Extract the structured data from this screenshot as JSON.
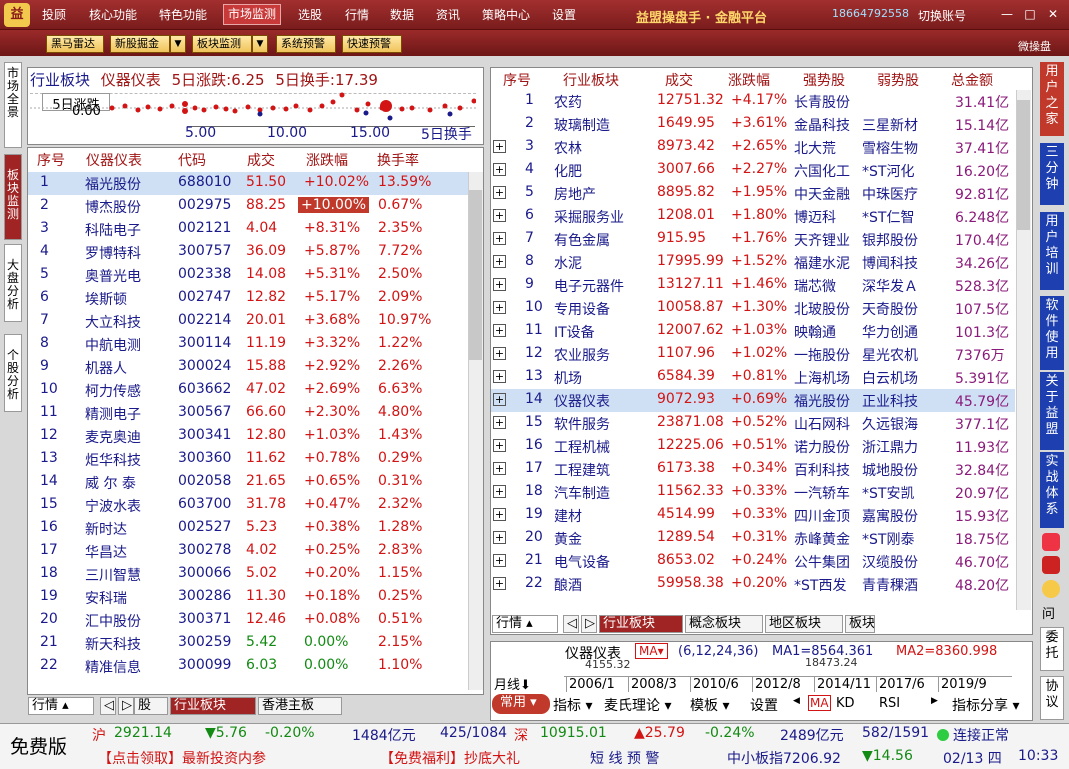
{
  "topbar": {
    "logo": "益",
    "menus": [
      "投顾",
      "核心功能",
      "特色功能",
      "市场监测",
      "选股",
      "行情",
      "数据",
      "资讯",
      "策略中心",
      "设置"
    ],
    "selected_menu": "市场监测",
    "brand": "益盟操盘手 · 金融平台",
    "phone": "18664792558",
    "switch_account": "切换账号",
    "window_controls": [
      "—",
      "□",
      "✕"
    ]
  },
  "toolbar": {
    "buttons": [
      "黑马雷达",
      "新股掘金",
      "板块监测",
      "系统预警",
      "快速预警"
    ],
    "right_label": "微操盘"
  },
  "left_tabs": [
    "市场全景",
    "板块监测",
    "大盘分析",
    "个股分析"
  ],
  "mini_chart": {
    "title": "行业板块",
    "sector": "仪器仪表",
    "info1": "5日涨跌:6.25",
    "info2": "5日换手:17.39",
    "legend": "5日涨跌",
    "y0": "0.00",
    "ticks": [
      "5.00",
      "10.00",
      "15.00"
    ],
    "xlabel": "5日换手"
  },
  "left_table": {
    "headers": [
      "序号",
      "仪器仪表",
      "代码",
      "成交",
      "涨跌幅",
      "换手率"
    ],
    "rows": [
      [
        "1",
        "福光股份",
        "688010",
        "51.50",
        "+10.02%",
        "13.59%"
      ],
      [
        "2",
        "博杰股份",
        "002975",
        "88.25",
        "+10.00%",
        "0.67%"
      ],
      [
        "3",
        "科陆电子",
        "002121",
        "4.04",
        "+8.31%",
        "2.35%"
      ],
      [
        "4",
        "罗博特科",
        "300757",
        "36.09",
        "+5.87%",
        "7.72%"
      ],
      [
        "5",
        "奥普光电",
        "002338",
        "14.08",
        "+5.31%",
        "2.50%"
      ],
      [
        "6",
        "埃斯顿",
        "002747",
        "12.82",
        "+5.17%",
        "2.09%"
      ],
      [
        "7",
        "大立科技",
        "002214",
        "20.01",
        "+3.68%",
        "10.97%"
      ],
      [
        "8",
        "中航电测",
        "300114",
        "11.19",
        "+3.32%",
        "1.22%"
      ],
      [
        "9",
        "机器人",
        "300024",
        "15.88",
        "+2.92%",
        "2.26%"
      ],
      [
        "10",
        "柯力传感",
        "603662",
        "47.02",
        "+2.69%",
        "6.63%"
      ],
      [
        "11",
        "精测电子",
        "300567",
        "66.60",
        "+2.30%",
        "4.80%"
      ],
      [
        "12",
        "麦克奥迪",
        "300341",
        "12.80",
        "+1.03%",
        "1.43%"
      ],
      [
        "13",
        "炬华科技",
        "300360",
        "11.62",
        "+0.78%",
        "0.29%"
      ],
      [
        "14",
        "威 尔 泰",
        "002058",
        "21.65",
        "+0.65%",
        "0.31%"
      ],
      [
        "15",
        "宁波水表",
        "603700",
        "31.78",
        "+0.47%",
        "2.32%"
      ],
      [
        "16",
        "新时达",
        "002527",
        "5.23",
        "+0.38%",
        "1.28%"
      ],
      [
        "17",
        "华昌达",
        "300278",
        "4.02",
        "+0.25%",
        "2.83%"
      ],
      [
        "18",
        "三川智慧",
        "300066",
        "5.02",
        "+0.20%",
        "1.15%"
      ],
      [
        "19",
        "安科瑞",
        "300286",
        "11.30",
        "+0.18%",
        "0.25%"
      ],
      [
        "20",
        "汇中股份",
        "300371",
        "12.46",
        "+0.08%",
        "0.51%"
      ],
      [
        "21",
        "新天科技",
        "300259",
        "5.42",
        "0.00%",
        "2.15%"
      ],
      [
        "22",
        "精准信息",
        "300099",
        "6.03",
        "0.00%",
        "1.10%"
      ]
    ]
  },
  "left_bottom_tabs": [
    "行情",
    "股",
    "行业板块",
    "香港主板"
  ],
  "right_table": {
    "headers": [
      "序号",
      "行业板块",
      "成交",
      "涨跌幅",
      "强势股",
      "弱势股",
      "总金额"
    ],
    "rows": [
      [
        "1",
        "农药",
        "12751.32",
        "+4.17%",
        "长青股份",
        "",
        "31.41亿"
      ],
      [
        "2",
        "玻璃制造",
        "1649.95",
        "+3.61%",
        "金晶科技",
        "三星新材",
        "15.14亿"
      ],
      [
        "3",
        "农林",
        "8973.42",
        "+2.65%",
        "北大荒",
        "雪榕生物",
        "37.41亿"
      ],
      [
        "4",
        "化肥",
        "3007.66",
        "+2.27%",
        "六国化工",
        "*ST河化",
        "16.20亿"
      ],
      [
        "5",
        "房地产",
        "8895.82",
        "+1.95%",
        "中天金融",
        "中珠医疗",
        "92.81亿"
      ],
      [
        "6",
        "采掘服务业",
        "1208.01",
        "+1.80%",
        "博迈科",
        "*ST仁智",
        "6.248亿"
      ],
      [
        "7",
        "有色金属",
        "915.95",
        "+1.76%",
        "天齐锂业",
        "银邦股份",
        "170.4亿"
      ],
      [
        "8",
        "水泥",
        "17995.99",
        "+1.52%",
        "福建水泥",
        "博闻科技",
        "34.26亿"
      ],
      [
        "9",
        "电子元器件",
        "13127.11",
        "+1.46%",
        "瑞芯微",
        "深华发Ａ",
        "528.3亿"
      ],
      [
        "10",
        "专用设备",
        "10058.87",
        "+1.30%",
        "北玻股份",
        "天奇股份",
        "107.5亿"
      ],
      [
        "11",
        "IT设备",
        "12007.62",
        "+1.03%",
        "映翰通",
        "华力创通",
        "101.3亿"
      ],
      [
        "12",
        "农业服务",
        "1107.96",
        "+1.02%",
        "一拖股份",
        "星光农机",
        "7376万"
      ],
      [
        "13",
        "机场",
        "6584.39",
        "+0.81%",
        "上海机场",
        "白云机场",
        "5.391亿"
      ],
      [
        "14",
        "仪器仪表",
        "9072.93",
        "+0.69%",
        "福光股份",
        "正业科技",
        "45.79亿"
      ],
      [
        "15",
        "软件服务",
        "23871.08",
        "+0.52%",
        "山石网科",
        "久远银海",
        "377.1亿"
      ],
      [
        "16",
        "工程机械",
        "12225.06",
        "+0.51%",
        "诺力股份",
        "浙江鼎力",
        "11.93亿"
      ],
      [
        "17",
        "工程建筑",
        "6173.38",
        "+0.34%",
        "百利科技",
        "城地股份",
        "32.84亿"
      ],
      [
        "18",
        "汽车制造",
        "11562.33",
        "+0.33%",
        "一汽轿车",
        "*ST安凯",
        "20.97亿"
      ],
      [
        "19",
        "建材",
        "4514.99",
        "+0.33%",
        "四川金顶",
        "嘉寓股份",
        "15.93亿"
      ],
      [
        "20",
        "黄金",
        "1289.54",
        "+0.31%",
        "赤峰黄金",
        "*ST刚泰",
        "18.75亿"
      ],
      [
        "21",
        "电气设备",
        "8653.02",
        "+0.24%",
        "公牛集团",
        "汉缆股份",
        "46.70亿"
      ],
      [
        "22",
        "酿酒",
        "59958.38",
        "+0.20%",
        "*ST西发",
        "青青稞酒",
        "48.20亿"
      ]
    ]
  },
  "right_bottom_tabs": [
    "行情",
    "行业板块",
    "概念板块",
    "地区板块",
    "板块"
  ],
  "kline": {
    "title": "仪器仪表",
    "ma": "MA",
    "params": "(6,12,24,36)",
    "ma1": "MA1=8564.361",
    "ma2": "MA2=8360.998",
    "price1": "4155.32",
    "price2": "18473.24",
    "period": "月线",
    "dates": [
      "2006/1",
      "2008/3",
      "2010/6",
      "2012/8",
      "2014/11",
      "2017/6",
      "2019/9"
    ]
  },
  "kline_tabs": [
    "常用",
    "指标",
    "麦氏理论",
    "模板",
    "设置",
    "MA",
    "KD",
    "RSI",
    "指标分享"
  ],
  "right_side_tabs": [
    "用户之家",
    "三分钟",
    "用户培训",
    "软件使用",
    "关于益盟",
    "实战体系",
    "委托",
    "协议"
  ],
  "status": {
    "free": "免费版",
    "sh_label": "沪",
    "sh_index": "2921.14",
    "sh_chg": "▼5.76",
    "sh_pct": "-0.20%",
    "sh_amt": "1484亿元",
    "sh_updown": "425/1084",
    "sz_label": "深",
    "sz_index": "10915.01",
    "sz_chg": "▲25.79",
    "sz_pct": "-0.24%",
    "sz_amt": "2489亿元",
    "sz_updown": "582/1591",
    "conn": "连接正常",
    "promo1": "【点击领取】最新投资内参",
    "promo2": "【免费福利】抄底大礼",
    "warn": "短 线 预 警",
    "zxb": "中小板指7206.92",
    "zxb_chg": "▼14.56",
    "date": "02/13 四",
    "time": "10:33"
  }
}
